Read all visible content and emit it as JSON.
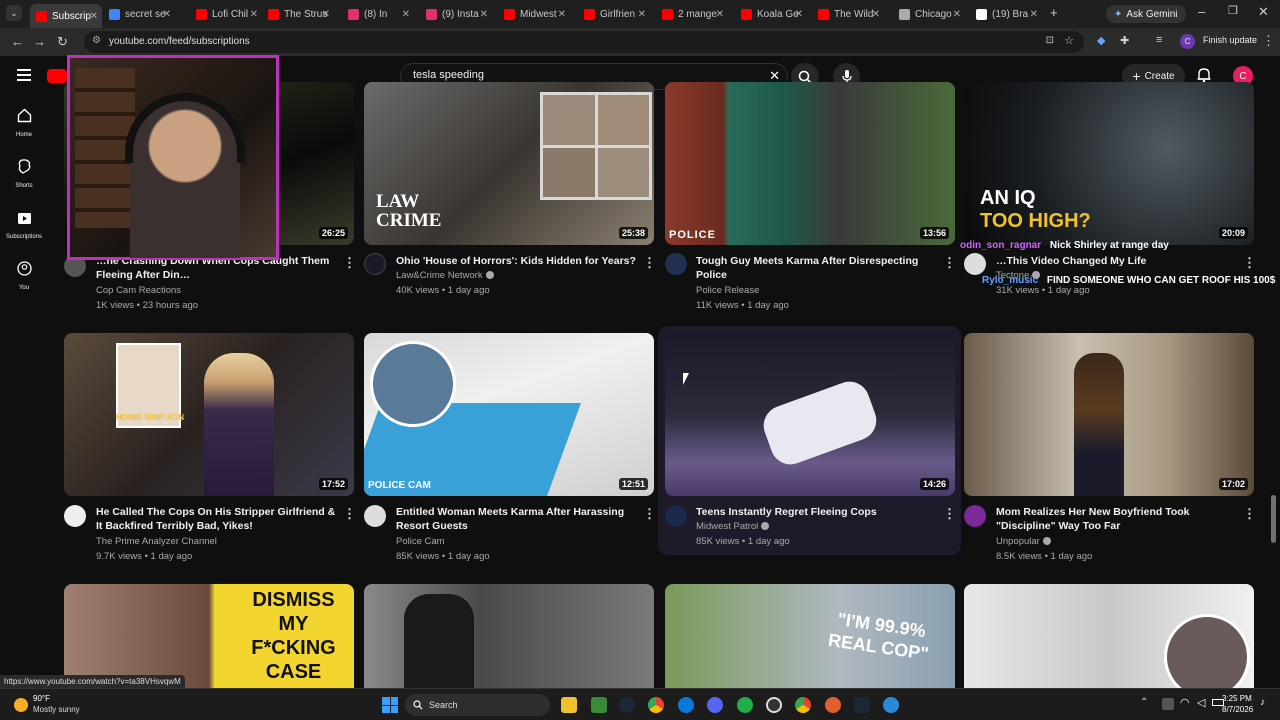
{
  "browser": {
    "tabs": [
      {
        "label": "Subscrip",
        "color": "#ff0000"
      },
      {
        "label": "secret se",
        "color": "#4285f4"
      },
      {
        "label": "Lofi Chil",
        "color": "#ff0000"
      },
      {
        "label": "The Strus",
        "color": "#ff0000"
      },
      {
        "label": "(8) In",
        "color": "#e1306c"
      },
      {
        "label": "(9) Insta",
        "color": "#e1306c"
      },
      {
        "label": "Midwest",
        "color": "#ff0000"
      },
      {
        "label": "Girlfrien",
        "color": "#ff0000"
      },
      {
        "label": "2 mange",
        "color": "#ff0000"
      },
      {
        "label": "Koala Ge",
        "color": "#ff0000"
      },
      {
        "label": "The Wild",
        "color": "#ff0000"
      },
      {
        "label": "Chicago",
        "color": "#aaaaaa"
      },
      {
        "label": "(19) Bra",
        "color": "#ffffff"
      }
    ],
    "ask_gemini": "Ask Gemini",
    "url": "youtube.com/feed/subscriptions",
    "finish_update": "Finish update",
    "profile_initial": "C"
  },
  "youtube": {
    "search_value": "tesla speeding",
    "create_label": "Create",
    "avatar_initial": "C",
    "sidebar": [
      {
        "label": "Home",
        "icon": "home-icon"
      },
      {
        "label": "Shorts",
        "icon": "shorts-icon"
      },
      {
        "label": "Subscriptions",
        "icon": "subscriptions-icon"
      },
      {
        "label": "You",
        "icon": "you-icon"
      }
    ]
  },
  "videos": [
    {
      "title": "…ne Crashing Down When Cops Caught Them Fleeing After Din…",
      "channel": "Cop Cam Reactions",
      "meta": "1K views • 23 hours ago",
      "duration": "26:25",
      "verified": false
    },
    {
      "title": "Ohio 'House of Horrors': Kids Hidden for Years?",
      "channel": "Law&Crime Network",
      "meta": "40K views • 1 day ago",
      "duration": "25:38",
      "verified": true
    },
    {
      "title": "Tough Guy Meets Karma After Disrespecting Police",
      "channel": "Police Release",
      "meta": "11K views • 1 day ago",
      "duration": "13:56",
      "verified": false
    },
    {
      "title": "…This Video Changed My Life",
      "channel": "Tectone",
      "meta": "31K views • 1 day ago",
      "duration": "20:09",
      "verified": true
    },
    {
      "title": "He Called The Cops On His Stripper Girlfriend & It Backfired Terribly Bad, Yikes!",
      "channel": "The Prime Analyzer Channel",
      "meta": "9.7K views • 1 day ago",
      "duration": "17:52",
      "verified": false
    },
    {
      "title": "Entitled Woman Meets Karma After Harassing Resort Guests",
      "channel": "Police Cam",
      "meta": "85K views • 1 day ago",
      "duration": "12:51",
      "verified": false
    },
    {
      "title": "Teens Instantly Regret Fleeing Cops",
      "channel": "Midwest Patrol",
      "meta": "85K views • 1 day ago",
      "duration": "14:26",
      "verified": true
    },
    {
      "title": "Mom Realizes Her New Boyfriend Took \"Discipline\" Way Too Far",
      "channel": "Unpopular",
      "meta": "8.5K views • 1 day ago",
      "duration": "17:02",
      "verified": true
    }
  ],
  "thumb_text": {
    "lawcrime": "LAW CRIME",
    "police_rel": "POLICE",
    "aniq": "AN IQ",
    "toohigh": "TOO HIGH?",
    "homewrecker": "HOMIE SIMP-SON",
    "policecam": "POLICE CAM",
    "dismiss": "DISMISS MY F*CKING CASE NOW!!",
    "realcop": "\"I'M 99.9% REAL COP\""
  },
  "chat": [
    {
      "user": "odin_son_ragnar",
      "msg": "Nick Shirley at range day",
      "color": "#d060ff"
    },
    {
      "user": "Rylo_music",
      "msg": "FIND SOMEONE WHO CAN GET ROOF HIS 100$",
      "color": "#6aa0ff"
    }
  ],
  "status_url": "https://www.youtube.com/watch?v=ta38VHsvqwM",
  "taskbar": {
    "weather_temp": "90°F",
    "weather_desc": "Mostly sunny",
    "search": "Search",
    "time": "3:25 PM",
    "date": "8/7/2026"
  }
}
